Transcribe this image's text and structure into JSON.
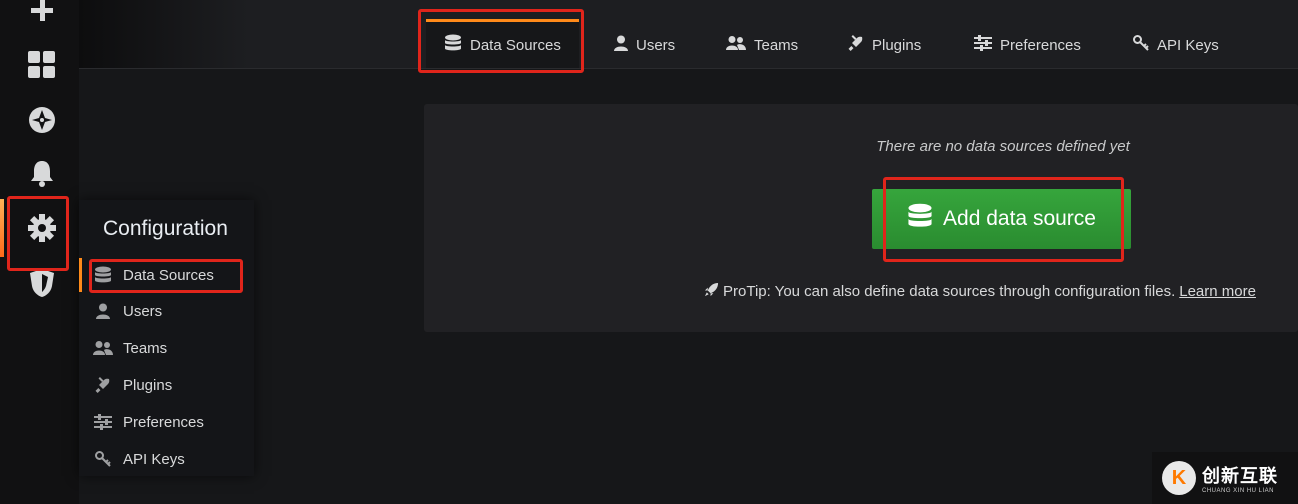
{
  "tabs": [
    {
      "label": "Data Sources",
      "icon": "database-icon",
      "active": true
    },
    {
      "label": "Users",
      "icon": "user-icon"
    },
    {
      "label": "Teams",
      "icon": "team-icon"
    },
    {
      "label": "Plugins",
      "icon": "plug-icon"
    },
    {
      "label": "Preferences",
      "icon": "sliders-icon"
    },
    {
      "label": "API Keys",
      "icon": "key-icon"
    }
  ],
  "sidebar": {
    "icons": [
      "plus-icon",
      "dashboards-icon",
      "explore-icon",
      "alerting-icon",
      "gear-icon",
      "shield-icon"
    ],
    "active": "gear-icon"
  },
  "empty_state": {
    "message": "There are no data sources defined yet",
    "button_label": "Add data source",
    "protip": "ProTip: You can also define data sources through configuration files.",
    "learn_more": "Learn more"
  },
  "config_menu": {
    "title": "Configuration",
    "items": [
      {
        "label": "Data Sources",
        "icon": "database-icon",
        "active": true
      },
      {
        "label": "Users",
        "icon": "user-icon"
      },
      {
        "label": "Teams",
        "icon": "team-icon"
      },
      {
        "label": "Plugins",
        "icon": "plug-icon"
      },
      {
        "label": "Preferences",
        "icon": "sliders-icon"
      },
      {
        "label": "API Keys",
        "icon": "key-icon"
      }
    ]
  },
  "watermark": {
    "mark": "K",
    "text": "创新互联",
    "subtext": "CHUANG XIN HU LIAN"
  },
  "colors": {
    "accent": "#ff8a1a",
    "button": "#2f9a35",
    "highlight": "#e0251b",
    "background": "#161719"
  }
}
